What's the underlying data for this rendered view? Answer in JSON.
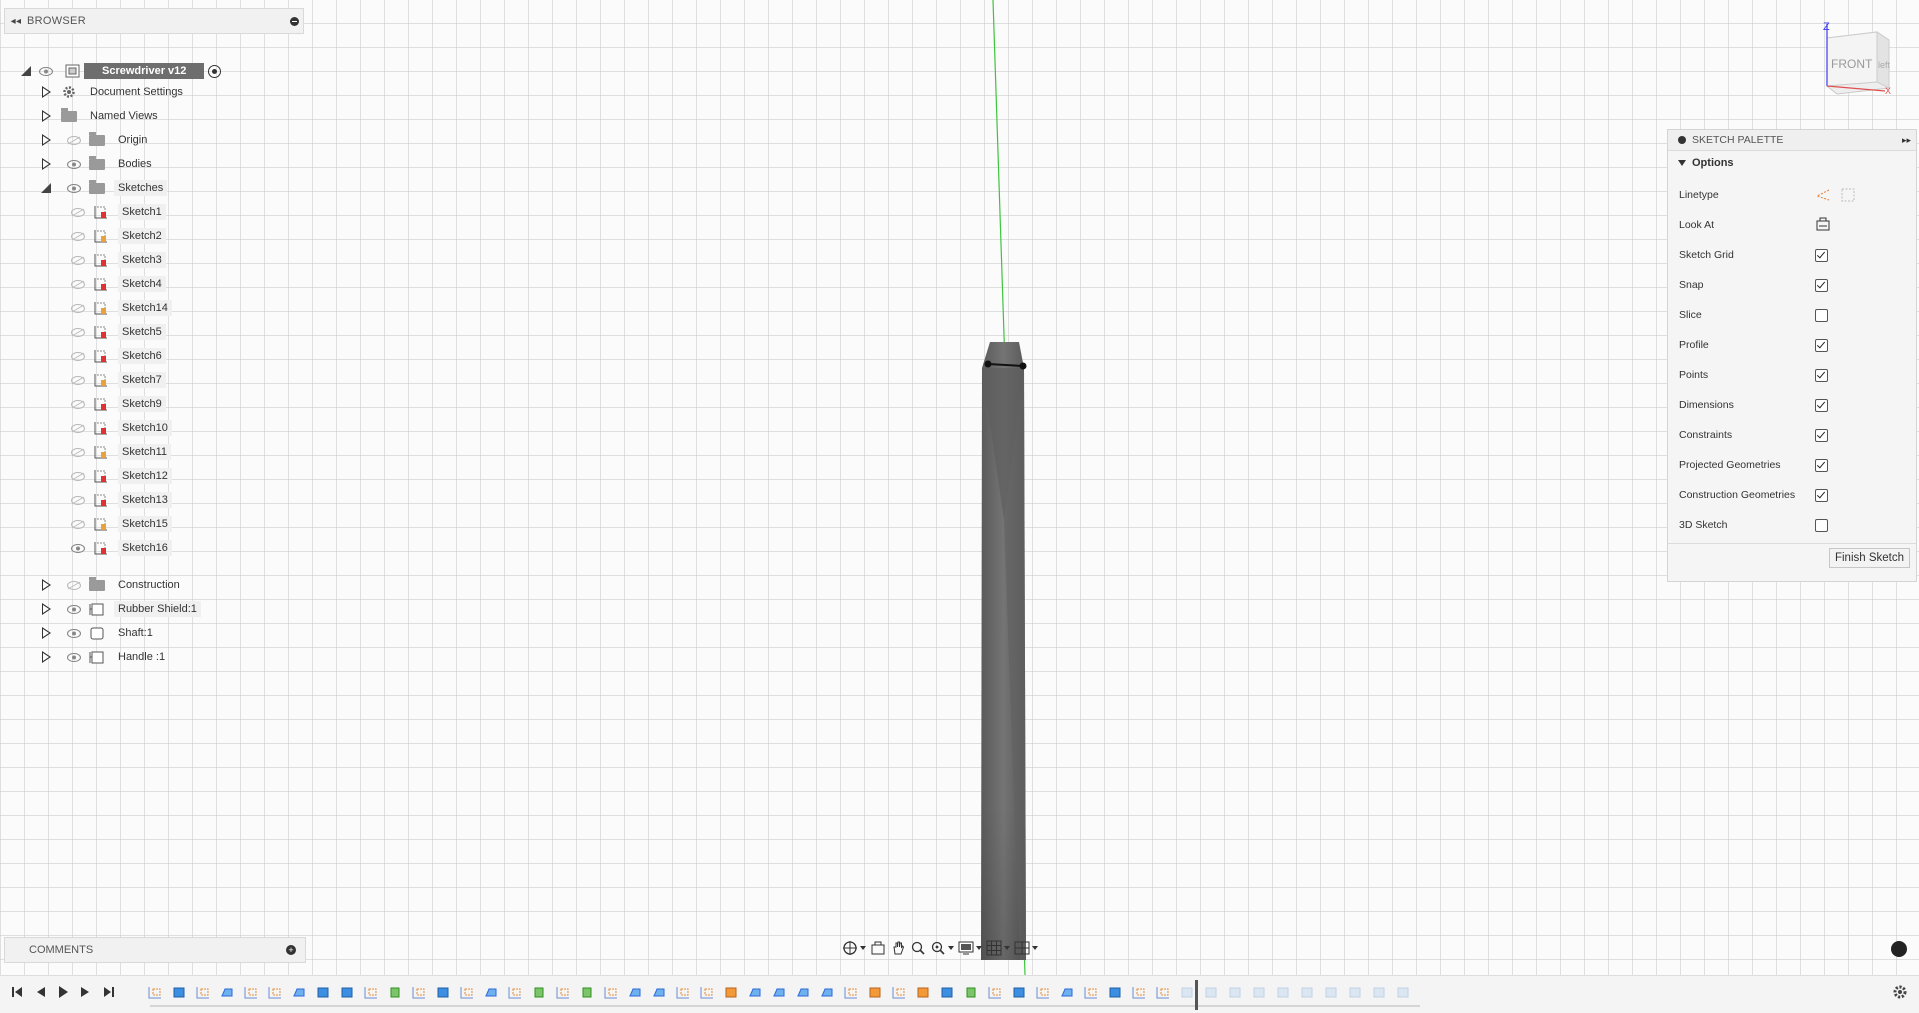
{
  "browser": {
    "title": "BROWSER",
    "root": "Screwdriver v12",
    "items": [
      {
        "label": "Document Settings",
        "icon": "gear-icon"
      },
      {
        "label": "Named Views",
        "icon": "folder-icon"
      },
      {
        "label": "Origin",
        "icon": "folder-icon"
      },
      {
        "label": "Bodies",
        "icon": "folder-icon"
      },
      {
        "label": "Sketches",
        "icon": "folder-icon"
      },
      {
        "label": "Construction",
        "icon": "folder-icon"
      },
      {
        "label": "Rubber Shield:1",
        "icon": "component-icon"
      },
      {
        "label": "Shaft:1",
        "icon": "component-icon"
      },
      {
        "label": "Handle :1",
        "icon": "component-icon"
      }
    ],
    "sketches": [
      "Sketch1",
      "Sketch2",
      "Sketch3",
      "Sketch4",
      "Sketch14",
      "Sketch5",
      "Sketch6",
      "Sketch7",
      "Sketch9",
      "Sketch10",
      "Sketch11",
      "Sketch12",
      "Sketch13",
      "Sketch15",
      "Sketch16"
    ]
  },
  "comments": {
    "title": "COMMENTS"
  },
  "palette": {
    "title": "SKETCH PALETTE",
    "section": "Options",
    "rows": [
      {
        "label": "Linetype",
        "type": "icons"
      },
      {
        "label": "Look At",
        "type": "icon"
      },
      {
        "label": "Sketch Grid",
        "checked": true
      },
      {
        "label": "Snap",
        "checked": true
      },
      {
        "label": "Slice",
        "checked": false
      },
      {
        "label": "Profile",
        "checked": true
      },
      {
        "label": "Points",
        "checked": true
      },
      {
        "label": "Dimensions",
        "checked": true
      },
      {
        "label": "Constraints",
        "checked": true
      },
      {
        "label": "Projected Geometries",
        "checked": true
      },
      {
        "label": "Construction Geometries",
        "checked": true
      },
      {
        "label": "3D Sketch",
        "checked": false
      }
    ],
    "finish": "Finish Sketch"
  },
  "viewcube": {
    "face": "FRONT",
    "side": "left",
    "axis_z": "Z",
    "axis_x": "X"
  },
  "colors": {
    "accent": "#2d6ad8",
    "axis_green": "#3ec43e",
    "body": "#6a6a6a"
  }
}
